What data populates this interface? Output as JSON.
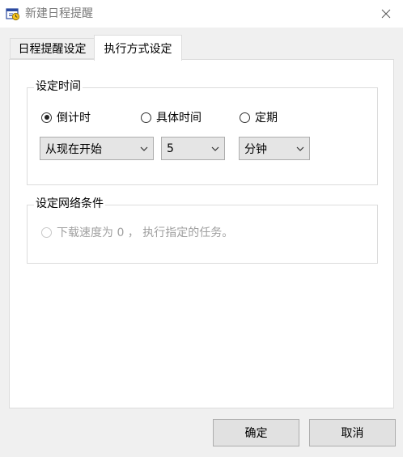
{
  "window": {
    "title": "新建日程提醒",
    "icon": "schedule-reminder-icon"
  },
  "tabs": [
    {
      "label": "日程提醒设定",
      "active": false
    },
    {
      "label": "执行方式设定",
      "active": true
    }
  ],
  "time_group": {
    "title": "设定时间",
    "radios": [
      {
        "label": "倒计时",
        "checked": true
      },
      {
        "label": "具体时间",
        "checked": false
      },
      {
        "label": "定期",
        "checked": false
      }
    ],
    "start": "从现在开始",
    "amount": "5",
    "unit": "分钟"
  },
  "network_group": {
    "title": "设定网络条件",
    "option": {
      "label": "下载速度为 0 ， 执行指定的任务。",
      "checked": false,
      "enabled": false
    }
  },
  "buttons": {
    "ok": "确定",
    "cancel": "取消"
  }
}
